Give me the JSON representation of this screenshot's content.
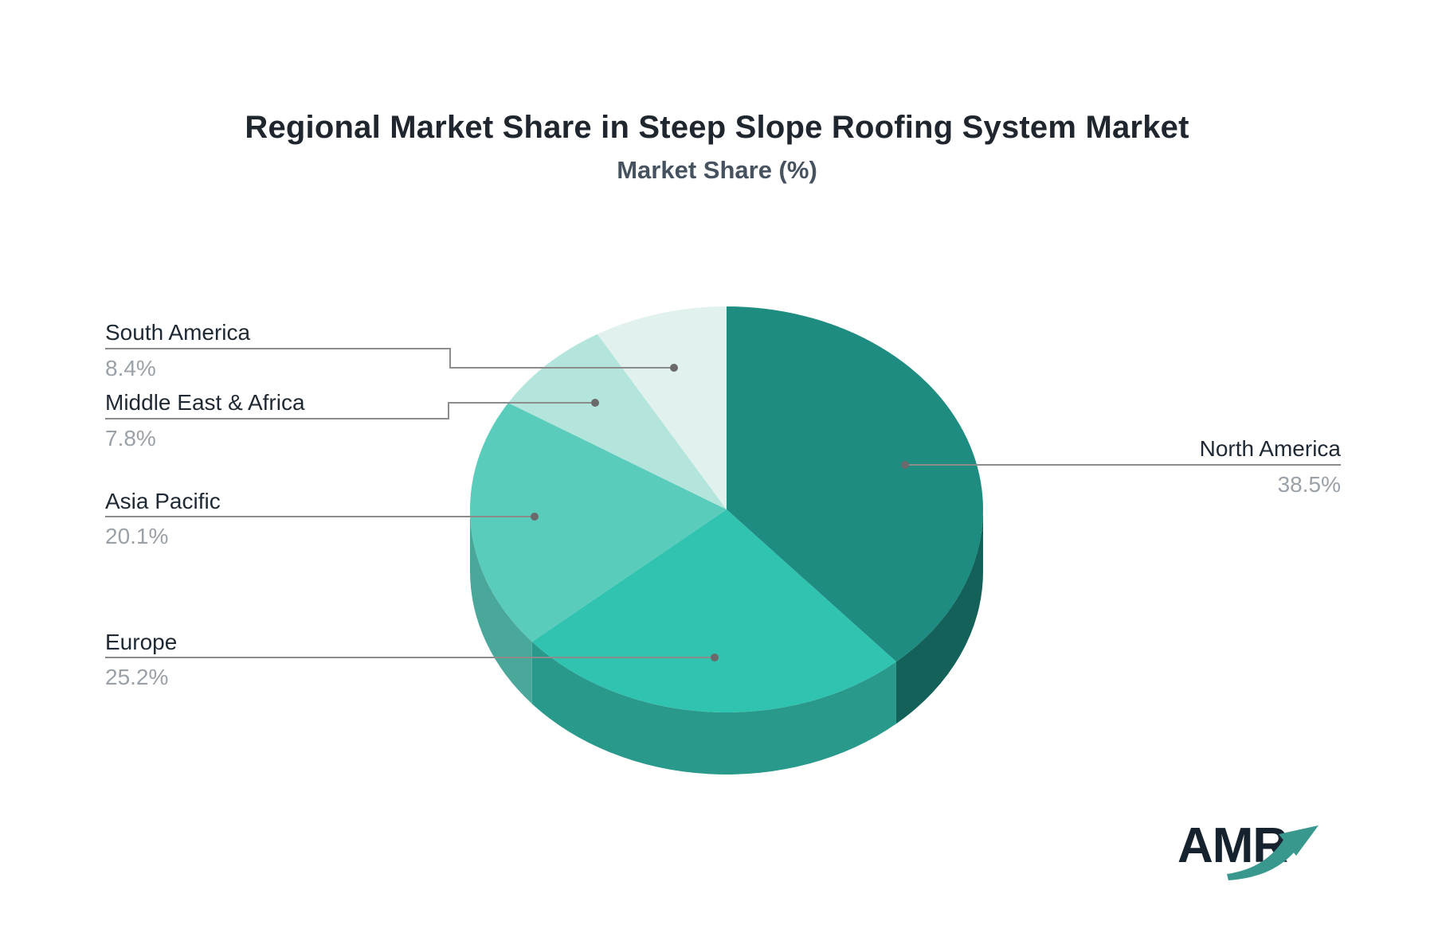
{
  "header": {
    "title": "Regional Market Share in Steep Slope Roofing System Market",
    "subtitle": "Market Share (%)"
  },
  "chart_data": {
    "type": "pie",
    "title": "Regional Market Share in Steep Slope Roofing System Market",
    "subtitle": "Market Share (%)",
    "unit": "%",
    "direction": "clockwise",
    "start_angle": "12-oclock",
    "style": "3d-pie-with-depth",
    "legend_position": "callout-leader-lines",
    "series": [
      {
        "label": "North America",
        "value": 38.5,
        "percent_text": "38.5%",
        "color": "#1e8c81",
        "side_color": "#136158"
      },
      {
        "label": "Europe",
        "value": 25.2,
        "percent_text": "25.2%",
        "color": "#30c3af",
        "side_color": "#28998b"
      },
      {
        "label": "Asia Pacific",
        "value": 20.1,
        "percent_text": "20.1%",
        "color": "#5accbb",
        "side_color": "#4aa89b"
      },
      {
        "label": "Middle East & Africa",
        "value": 7.8,
        "percent_text": "7.8%",
        "color": "#b3e5dd",
        "side_color": "#8fc9c0"
      },
      {
        "label": "South America",
        "value": 8.4,
        "percent_text": "8.4%",
        "color": "#e1f1ee",
        "side_color": "#c2ddd8"
      }
    ],
    "leader_line_color": "#8c8c8c",
    "leader_dot_color": "#6a6a6a",
    "label_name_color": "#1f2933",
    "label_percent_color": "#9aa1a8"
  },
  "logo": {
    "text": "AMR",
    "text_color": "#16232e",
    "arrow_color": "#38988e",
    "arrow_icon": "trend-up-arrow"
  }
}
